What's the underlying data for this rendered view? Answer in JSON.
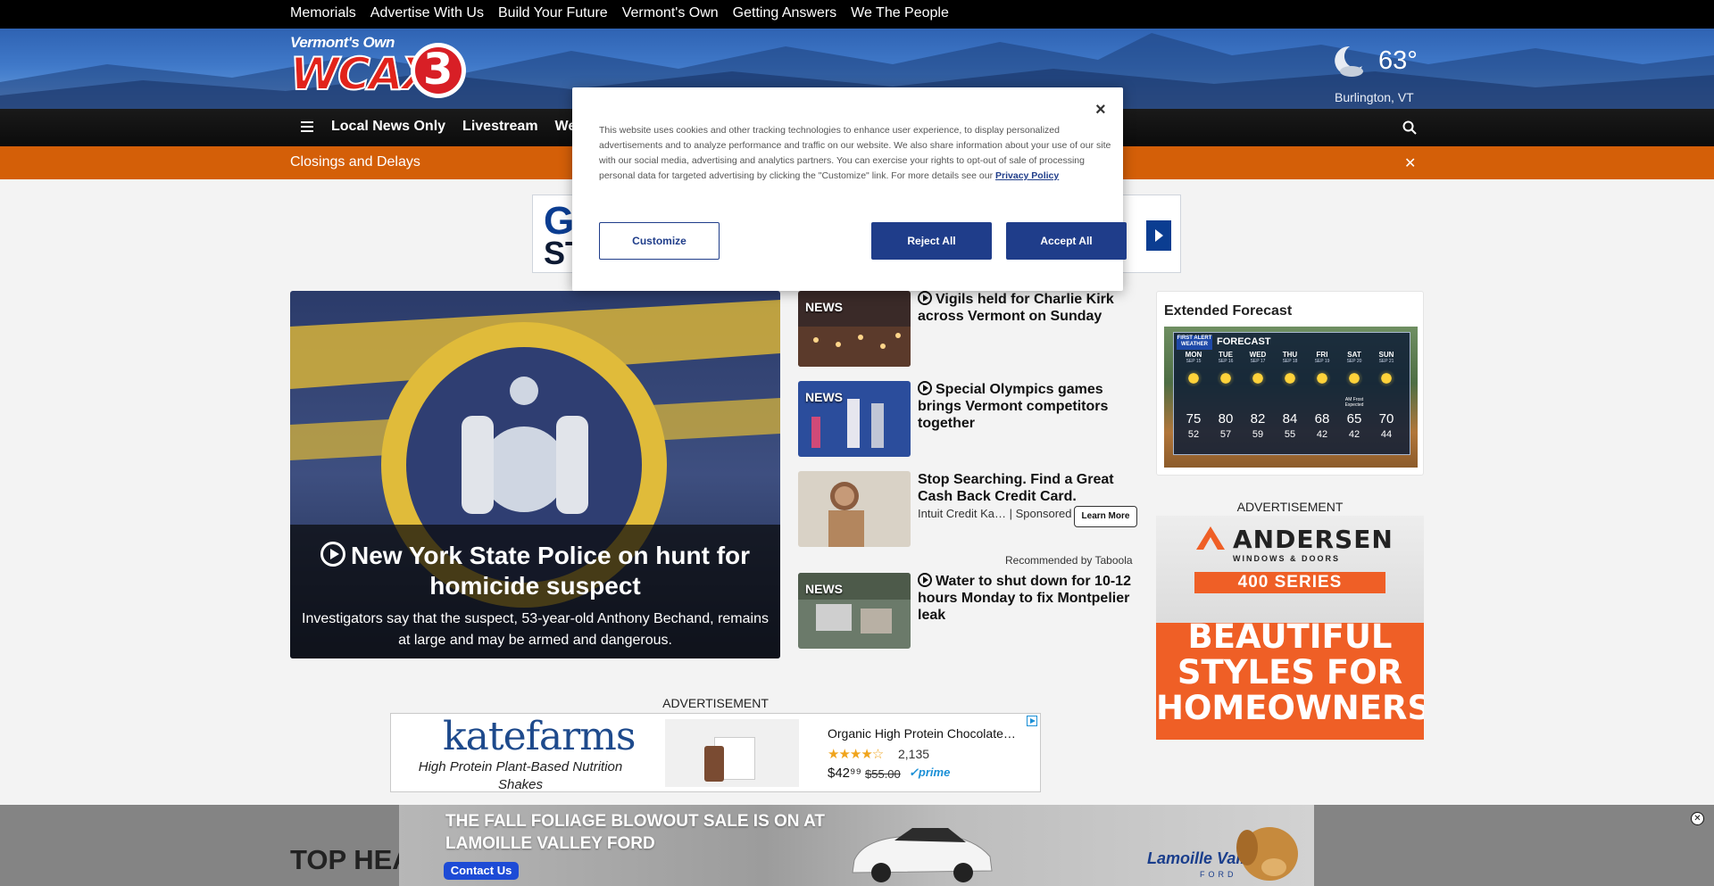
{
  "utility_nav": [
    "Memorials",
    "Advertise With Us",
    "Build Your Future",
    "Vermont's Own",
    "Getting Answers",
    "We The People"
  ],
  "logo": {
    "tagline": "Vermont's Own",
    "wordmark": "WCAX",
    "channel": "3"
  },
  "weather": {
    "temp": "63°",
    "location": "Burlington, VT",
    "icon": "moon-cloud-icon"
  },
  "main_nav": [
    "Local News Only",
    "Livestream",
    "Wea"
  ],
  "alert": {
    "text": "Closings and Delays"
  },
  "top_ad": {
    "line1": "GE",
    "line2": "STA"
  },
  "hero": {
    "headline": "New York State Police on hunt for homicide suspect",
    "summary": "Investigators say that the suspect, 53-year-old Anthony Bechand, remains at large and may be armed and dangerous."
  },
  "stories": [
    {
      "badge": "NEWS",
      "title": "Vigils held for Charlie Kirk across Vermont on Sunday",
      "video": true
    },
    {
      "badge": "NEWS",
      "title": "Special Olympics games brings Vermont competitors together",
      "video": true
    },
    {
      "badge": "",
      "title": "Stop Searching. Find a Great Cash Back Credit Card.",
      "source": "Intuit Credit Ka…",
      "sponsored": "| Sponsored",
      "button": "Learn More"
    },
    {
      "badge": "NEWS",
      "title": "Water to shut down for 10-12 hours Monday to fix Montpelier leak",
      "video": true
    }
  ],
  "recommended_by": "Recommended by Taboola",
  "forecast": {
    "title": "Extended Forecast",
    "logo_text": "FIRST ALERT WEATHER",
    "header": "FORECAST",
    "days": [
      {
        "day": "MON",
        "date": "SEP 15",
        "hi": "75",
        "lo": "52",
        "note": ""
      },
      {
        "day": "TUE",
        "date": "SEP 16",
        "hi": "80",
        "lo": "57",
        "note": ""
      },
      {
        "day": "WED",
        "date": "SEP 17",
        "hi": "82",
        "lo": "59",
        "note": ""
      },
      {
        "day": "THU",
        "date": "SEP 18",
        "hi": "84",
        "lo": "55",
        "note": ""
      },
      {
        "day": "FRI",
        "date": "SEP 19",
        "hi": "68",
        "lo": "42",
        "note": ""
      },
      {
        "day": "SAT",
        "date": "SEP 20",
        "hi": "65",
        "lo": "42",
        "note": "AM Frost Expected"
      },
      {
        "day": "SUN",
        "date": "SEP 21",
        "hi": "70",
        "lo": "44",
        "note": ""
      }
    ]
  },
  "ad_label": "ADVERTISEMENT",
  "andersen_ad": {
    "brand": "ANDERSEN",
    "sub": "WINDOWS & DOORS",
    "series": "400 SERIES",
    "tagline_1": "BEAUTIFUL",
    "tagline_2": "STYLES FOR",
    "tagline_3": "HOMEOWNERS."
  },
  "kate_ad": {
    "brand": "katefarms",
    "tagline": "High Protein Plant-Based Nutrition Shakes",
    "product": "Organic High Protein Chocolate…",
    "rating_count": "2,135",
    "price": "$42⁹⁹",
    "was": "$55.00",
    "prime": "✓prime"
  },
  "section_heading": "TOP HEA",
  "sticky_ad": {
    "headline": "THE FALL FOLIAGE BLOWOUT SALE IS ON AT LAMOILLE VALLEY FORD",
    "button": "Contact Us",
    "dealer": "Lamoille Valley",
    "dealer_sub": "FORD"
  },
  "cookie_modal": {
    "text": "This website uses cookies and other tracking technologies to enhance user experience, to display personalized advertisements and to analyze performance and traffic on our website. We also share information about your use of our site with our social media, advertising and analytics partners. You can exercise your rights to opt-out of sale of processing personal data for targeted advertising by clicking the \"Customize\" link. For more details see our",
    "policy_link": "Privacy Policy",
    "customize": "Customize",
    "reject": "Reject All",
    "accept": "Accept All",
    "close": "×"
  }
}
